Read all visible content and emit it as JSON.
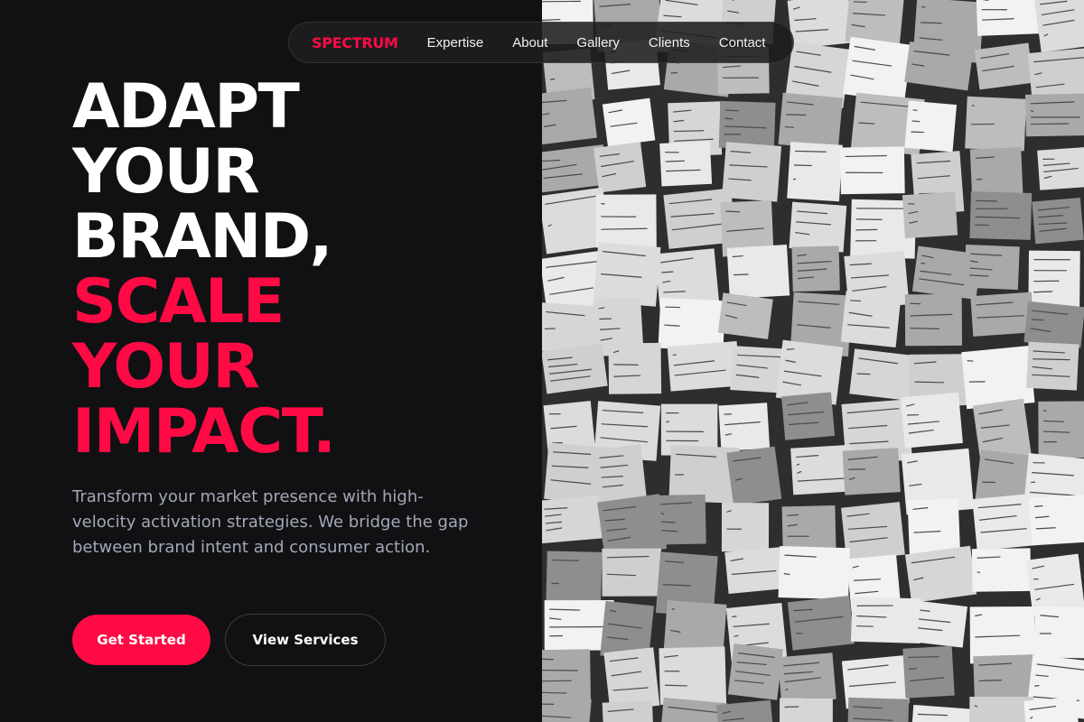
{
  "brand": {
    "logo": "SPECTRUM",
    "accent": "#ff0a45",
    "background": "#111113"
  },
  "nav": {
    "items": [
      {
        "label": "Expertise"
      },
      {
        "label": "About"
      },
      {
        "label": "Gallery"
      },
      {
        "label": "Clients"
      },
      {
        "label": "Contact"
      }
    ]
  },
  "hero": {
    "headline_white": [
      "ADAPT",
      "YOUR",
      "BRAND,"
    ],
    "headline_red": [
      "SCALE",
      "YOUR",
      "IMPACT."
    ],
    "subtext": "Transform your market presence with high-velocity activation strategies. We bridge the gap between brand intent and consumer action.",
    "primary_cta": "Get Started",
    "secondary_cta": "View Services"
  },
  "image": {
    "subject": "wall-of-handwritten-sticky-notes",
    "tone": "grayscale"
  }
}
